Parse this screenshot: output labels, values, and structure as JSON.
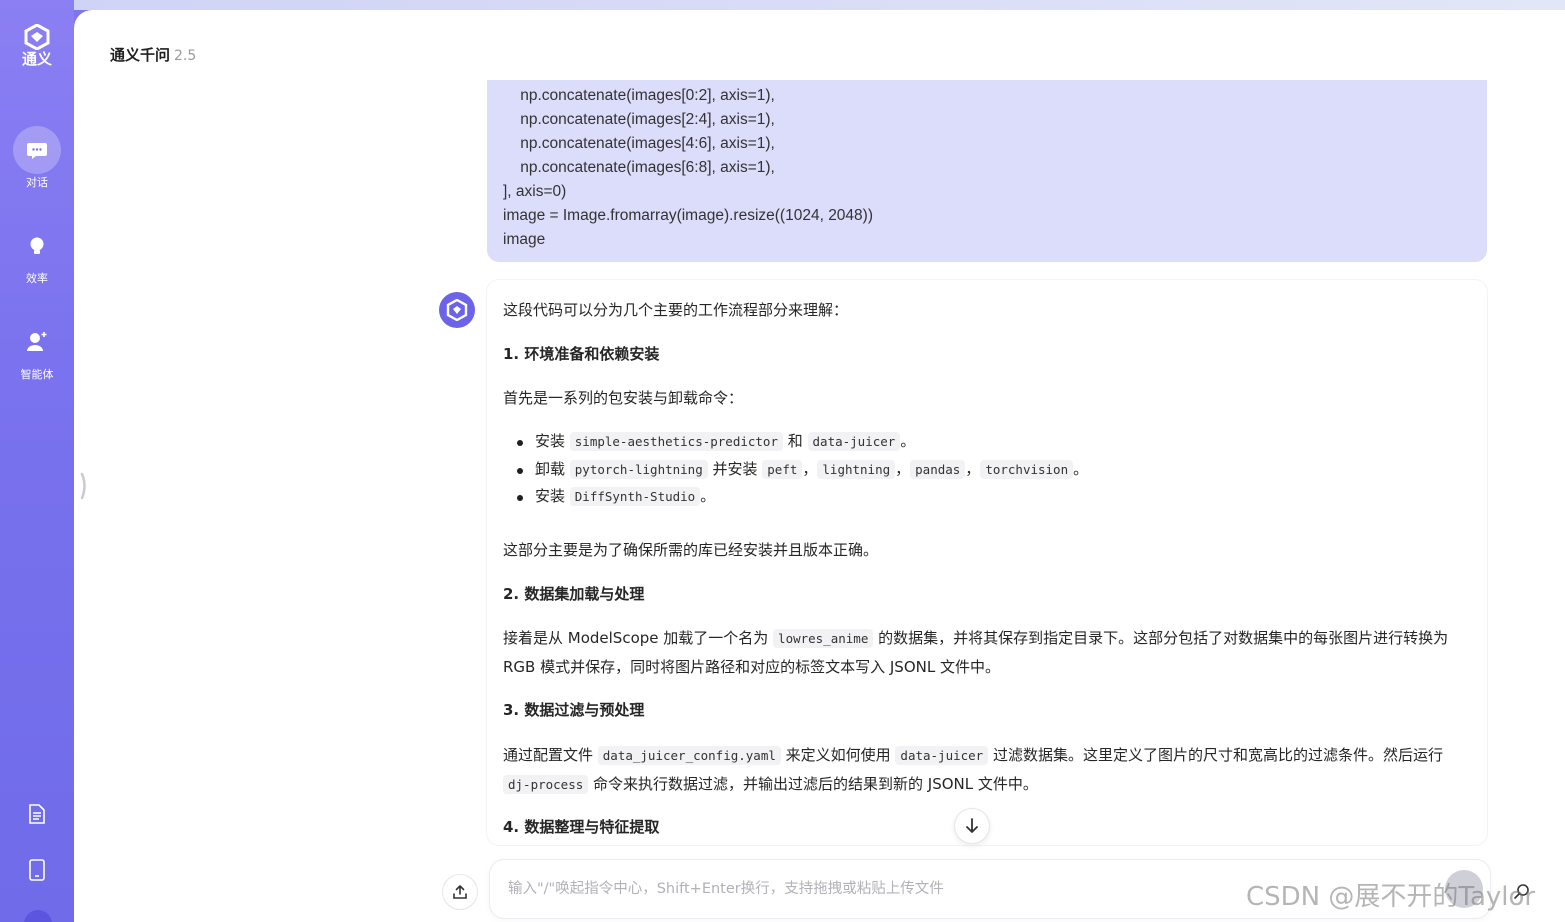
{
  "brand": {
    "name": "通义"
  },
  "sidebar": {
    "items": [
      {
        "label": "对话",
        "icon": "chat-bubble-icon",
        "active": true
      },
      {
        "label": "效率",
        "icon": "lightbulb-icon",
        "active": false
      },
      {
        "label": "智能体",
        "icon": "agent-icon",
        "active": false
      }
    ],
    "bottom_icons": [
      "document-icon",
      "tablet-icon"
    ]
  },
  "header": {
    "title": "通义千问",
    "version": "2.5"
  },
  "user_message": {
    "code_lines": [
      "    np.concatenate(images[0:2], axis=1),",
      "    np.concatenate(images[2:4], axis=1),",
      "    np.concatenate(images[4:6], axis=1),",
      "    np.concatenate(images[6:8], axis=1),",
      "], axis=0)",
      "image = Image.fromarray(image).resize((1024, 2048))",
      "image"
    ]
  },
  "response": {
    "intro": "这段代码可以分为几个主要的工作流程部分来理解：",
    "section1": {
      "heading": "1. 环境准备和依赖安装",
      "lead": "首先是一系列的包安装与卸载命令：",
      "bullets": [
        {
          "pre": "安装 ",
          "code1": "simple-aesthetics-predictor",
          "mid": " 和 ",
          "code2": "data-juicer",
          "post": "。"
        },
        {
          "pre": "卸载 ",
          "code1": "pytorch-lightning",
          "mid": " 并安装 ",
          "codes": [
            "peft",
            "lightning",
            "pandas",
            "torchvision"
          ],
          "post": "。"
        },
        {
          "pre": "安装 ",
          "code1": "DiffSynth-Studio",
          "post": "。"
        }
      ],
      "summary": "这部分主要是为了确保所需的库已经安装并且版本正确。"
    },
    "section2": {
      "heading": "2. 数据集加载与处理",
      "text_a": "接着是从 ModelScope 加载了一个名为 ",
      "code": "lowres_anime",
      "text_b": " 的数据集，并将其保存到指定目录下。这部分包括了对数据集中的每张图片进行转换为 RGB 模式并保存，同时将图片路径和对应的标签文本写入 JSONL 文件中。"
    },
    "section3": {
      "heading": "3. 数据过滤与预处理",
      "text_a": "通过配置文件 ",
      "code1": "data_juicer_config.yaml",
      "text_b": " 来定义如何使用 ",
      "code2": "data-juicer",
      "text_c": " 过滤数据集。这里定义了图片的尺寸和宽高比的过滤条件。然后运行 ",
      "code3": "dj-process",
      "text_d": " 命令来执行数据过滤，并输出过滤后的结果到新的 JSONL 文件中。"
    },
    "section4": {
      "heading": "4. 数据整理与特征提取"
    }
  },
  "input": {
    "placeholder": "输入\"/\"唤起指令中心，Shift+Enter换行，支持拖拽或粘贴上传文件"
  },
  "watermark": "CSDN @展不开的Taylor",
  "colors": {
    "sidebar": "#7a72ee",
    "user_bubble": "#dcdcfb",
    "accent": "#6d63e8"
  }
}
